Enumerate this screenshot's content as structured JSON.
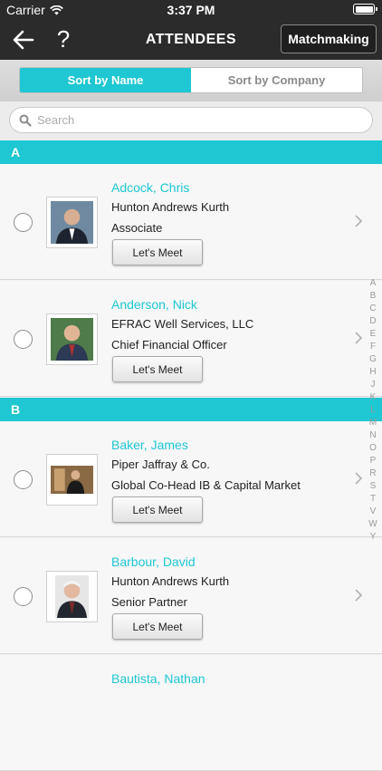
{
  "status": {
    "carrier": "Carrier",
    "time": "3:37 PM"
  },
  "nav": {
    "title": "ATTENDEES",
    "help_label": "?",
    "matchmaking_label": "Matchmaking"
  },
  "sort": {
    "by_name": "Sort by Name",
    "by_company": "Sort by Company",
    "active": "name"
  },
  "search": {
    "placeholder": "Search"
  },
  "sections": [
    {
      "letter": "A",
      "attendees": [
        {
          "name": "Adcock, Chris",
          "company": "Hunton Andrews Kurth",
          "title": "Associate",
          "button": "Let's Meet"
        },
        {
          "name": "Anderson, Nick",
          "company": "EFRAC Well Services, LLC",
          "title": "Chief Financial Officer",
          "button": "Let's Meet"
        }
      ]
    },
    {
      "letter": "B",
      "attendees": [
        {
          "name": "Baker, James",
          "company": "Piper Jaffray & Co.",
          "title": "Global Co-Head IB & Capital Market",
          "button": "Let's Meet"
        },
        {
          "name": "Barbour, David",
          "company": "Hunton Andrews Kurth",
          "title": "Senior Partner",
          "button": "Let's Meet"
        },
        {
          "name": "Bautista, Nathan"
        }
      ]
    }
  ],
  "index_letters": [
    "A",
    "B",
    "C",
    "D",
    "E",
    "F",
    "G",
    "H",
    "J",
    "K",
    "L",
    "M",
    "N",
    "O",
    "P",
    "R",
    "S",
    "T",
    "V",
    "W",
    "Y"
  ],
  "colors": {
    "accent": "#1ec7d2",
    "nav_bg": "#2b2b2b"
  }
}
